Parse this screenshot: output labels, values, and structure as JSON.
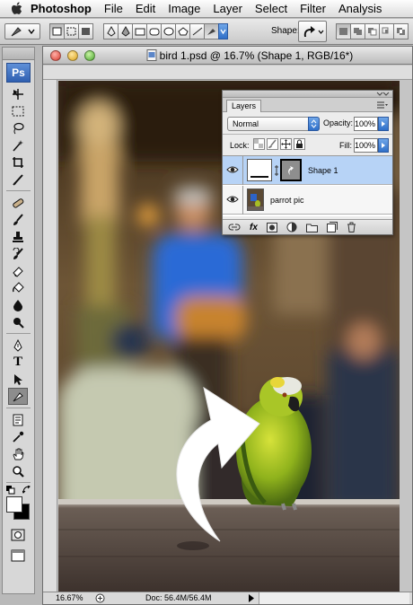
{
  "menubar": {
    "app_name": "Photoshop",
    "items": [
      "File",
      "Edit",
      "Image",
      "Layer",
      "Select",
      "Filter",
      "Analysis"
    ]
  },
  "optionsbar": {
    "shape_label": "Shape:"
  },
  "document": {
    "title": "bird 1.psd @ 16.7% (Shape 1, RGB/16*)",
    "zoom": "16.67%",
    "doc_size": "Doc: 56.4M/56.4M"
  },
  "toolbox": {
    "logo": "Ps",
    "type_tool_label": "T"
  },
  "layers_panel": {
    "tab_label": "Layers",
    "blend_mode": "Normal",
    "opacity_label": "Opacity:",
    "opacity_value": "100%",
    "lock_label": "Lock:",
    "fill_label": "Fill:",
    "fill_value": "100%",
    "layers": [
      {
        "name": "Shape 1",
        "selected": true
      },
      {
        "name": "parrot pic",
        "selected": false
      }
    ],
    "fx_label": "fx"
  },
  "colors": {
    "selection_blue": "#b7d3f6",
    "accent_blue": "#2f6fc8"
  }
}
